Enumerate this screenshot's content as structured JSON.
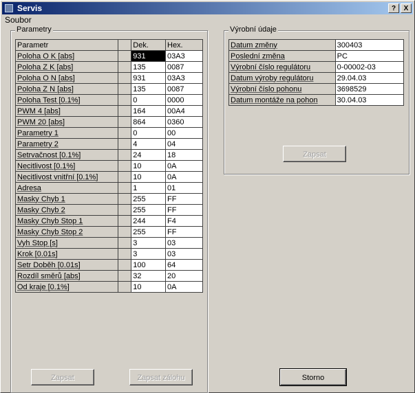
{
  "window": {
    "title": "Servis",
    "help_glyph": "?",
    "close_glyph": "X"
  },
  "menu": {
    "items": [
      "Soubor"
    ]
  },
  "params": {
    "group_label": "Parametry",
    "headers": {
      "name": "Parametr",
      "dek": "Dek.",
      "hex": "Hex."
    },
    "rows": [
      {
        "name": "Poloha O K [abs]",
        "dek": "931",
        "hex": "03A3",
        "selected": true
      },
      {
        "name": "Poloha Z K [abs]",
        "dek": "135",
        "hex": "0087"
      },
      {
        "name": "Poloha O N [abs]",
        "dek": "931",
        "hex": "03A3"
      },
      {
        "name": "Poloha Z N [abs]",
        "dek": "135",
        "hex": "0087"
      },
      {
        "name": "Poloha Test [0.1%]",
        "dek": "0",
        "hex": "0000"
      },
      {
        "name": "PWM 4 [abs]",
        "dek": "164",
        "hex": "00A4"
      },
      {
        "name": "PWM 20 [abs]",
        "dek": "864",
        "hex": "0360"
      },
      {
        "name": "Parametry 1",
        "dek": "0",
        "hex": "00"
      },
      {
        "name": "Parametry 2",
        "dek": "4",
        "hex": "04"
      },
      {
        "name": "Setrvačnost [0.1%]",
        "dek": "24",
        "hex": "18"
      },
      {
        "name": "Necitlivost [0.1%]",
        "dek": "10",
        "hex": "0A"
      },
      {
        "name": "Necitlivost vnitřní [0.1%]",
        "dek": "10",
        "hex": "0A"
      },
      {
        "name": "Adresa",
        "dek": "1",
        "hex": "01"
      },
      {
        "name": "Masky Chyb 1",
        "dek": "255",
        "hex": "FF"
      },
      {
        "name": "Masky Chyb 2",
        "dek": "255",
        "hex": "FF"
      },
      {
        "name": "Masky Chyb Stop 1",
        "dek": "244",
        "hex": "F4"
      },
      {
        "name": "Masky Chyb Stop 2",
        "dek": "255",
        "hex": "FF"
      },
      {
        "name": "Vyh Stop [s]",
        "dek": "3",
        "hex": "03"
      },
      {
        "name": "Krok [0.01s]",
        "dek": "3",
        "hex": "03"
      },
      {
        "name": "Setr Doběh [0.01s]",
        "dek": "100",
        "hex": "64"
      },
      {
        "name": "Rozdíl směrů [abs]",
        "dek": "32",
        "hex": "20"
      },
      {
        "name": "Od kraje [0.1%]",
        "dek": "10",
        "hex": "0A"
      }
    ]
  },
  "vyrobni": {
    "group_label": "Výrobní údaje",
    "rows": [
      {
        "label": "Datum změny",
        "value": "300403"
      },
      {
        "label": "Poslední změna",
        "value": "PC"
      },
      {
        "label": "Výrobní číslo regulátoru",
        "value": "0-00002-03"
      },
      {
        "label": "Datum výroby regulátoru",
        "value": "29.04.03"
      },
      {
        "label": "Výrobní číslo pohonu",
        "value": "3698529"
      },
      {
        "label": "Datum montáže na pohon",
        "value": "30.04.03"
      }
    ],
    "zapsat_label": "Zapsat"
  },
  "buttons": {
    "zapsat": "Zapsat",
    "zapsat_zalohu": "Zapsat zálohu",
    "storno": "Storno"
  }
}
